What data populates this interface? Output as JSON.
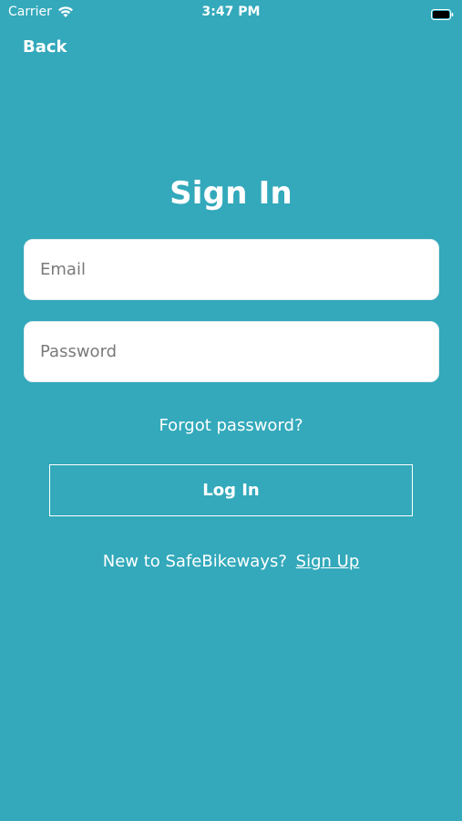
{
  "status_bar": {
    "carrier": "Carrier",
    "time": "3:47 PM",
    "wifi_icon": "wifi-icon",
    "battery_icon": "battery-icon"
  },
  "nav": {
    "back_label": "Back"
  },
  "form": {
    "title": "Sign In",
    "email": {
      "placeholder": "Email",
      "value": ""
    },
    "password": {
      "placeholder": "Password",
      "value": ""
    },
    "forgot_label": "Forgot password?",
    "login_label": "Log In"
  },
  "footer": {
    "prompt": "New to SafeBikeways?",
    "signup_label": "Sign Up"
  },
  "colors": {
    "background": "#33a9bb",
    "text": "#ffffff",
    "field_bg": "#ffffff"
  }
}
